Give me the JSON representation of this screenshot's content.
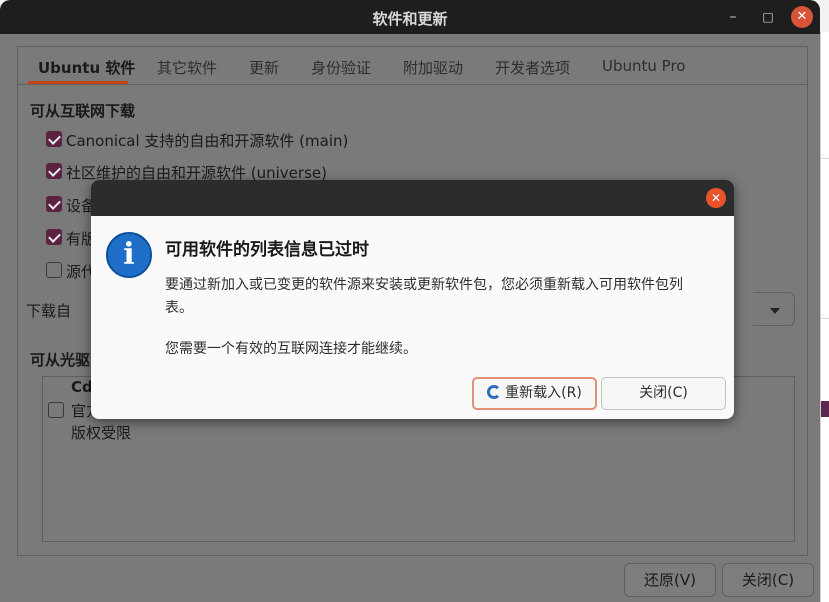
{
  "window": {
    "title": "软件和更新",
    "minimize": "–",
    "maximize": "□",
    "close": "✕"
  },
  "tabs": [
    {
      "label": "Ubuntu 软件",
      "active": true
    },
    {
      "label": "其它软件"
    },
    {
      "label": "更新"
    },
    {
      "label": "身份验证"
    },
    {
      "label": "附加驱动"
    },
    {
      "label": "开发者选项"
    },
    {
      "label": "Ubuntu Pro"
    }
  ],
  "internet_section": {
    "heading": "可从互联网下载",
    "items": [
      {
        "label": "Canonical 支持的自由和开源软件 (main)",
        "checked": true
      },
      {
        "label": "社区维护的自由和开源软件 (universe)",
        "checked": true
      },
      {
        "label": "设备",
        "checked": true
      },
      {
        "label": "有版",
        "checked": true
      },
      {
        "label": "源代",
        "checked": false
      }
    ],
    "download_from_label": "下载自"
  },
  "cdrom_section": {
    "heading": "可从光驱",
    "item_title": "Cd",
    "item_line2": "官方",
    "item_line3": "版权受限",
    "checked": false
  },
  "footer": {
    "revert_label": "还原(V)",
    "close_label": "关闭(C)"
  },
  "dialog": {
    "close": "✕",
    "icon": "i",
    "title": "可用软件的列表信息已过时",
    "body_line1": "要通过新加入或已变更的软件源来安装或更新软件包，您必须重新载入可用软件包列",
    "body_line2": "表。",
    "body_line3": "您需要一个有效的互联网连接才能继续。",
    "reload_label": "重新载入(R)",
    "close_label": "关闭(C)"
  },
  "colors": {
    "accent": "#c34113",
    "checkbox": "#5b2241",
    "close_button": "#d85439",
    "info_icon": "#1f6fc8"
  }
}
